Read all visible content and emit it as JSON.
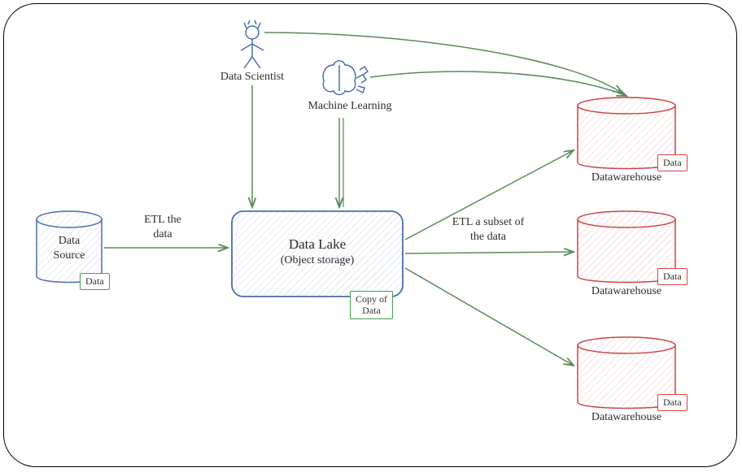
{
  "nodes": {
    "data_scientist": {
      "label": "Data Scientist"
    },
    "machine_learning": {
      "label": "Machine Learning"
    },
    "data_source": {
      "label": "Data\nSource",
      "tag": "Data"
    },
    "data_lake": {
      "line1": "Data Lake",
      "line2": "(Object storage)",
      "tag": "Copy of\nData"
    },
    "dw1": {
      "label": "Datawarehouse",
      "tag": "Data"
    },
    "dw2": {
      "label": "Datawarehouse",
      "tag": "Data"
    },
    "dw3": {
      "label": "Datawarehouse",
      "tag": "Data"
    }
  },
  "edges": {
    "etl_data": "ETL the\ndata",
    "etl_subset": "ETL a subset of\nthe data"
  }
}
